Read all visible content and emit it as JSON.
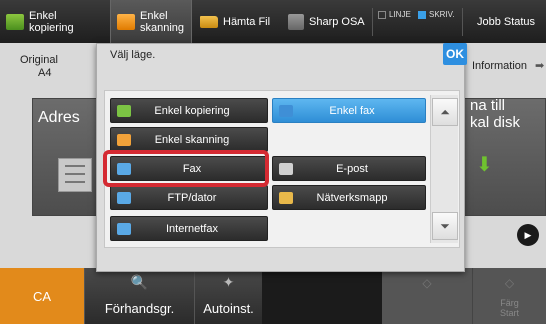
{
  "topbar": {
    "tabs": [
      {
        "label1": "Enkel",
        "label2": "kopiering",
        "icon": "copy-icon"
      },
      {
        "label1": "Enkel",
        "label2": "skanning",
        "icon": "scan-icon"
      },
      {
        "label": "Hämta Fil",
        "icon": "folder-icon"
      },
      {
        "label": "Sharp OSA",
        "icon": "osa-icon"
      }
    ],
    "indicators": {
      "line": "LINJE",
      "print": "SKRIV."
    },
    "job_status": "Jobb Status"
  },
  "background": {
    "original_label": "Original",
    "original_value": "A4",
    "info_label": "Information",
    "address_label": "Adres",
    "right_label_1": "na till",
    "right_label_2": "kal disk"
  },
  "modal": {
    "title": "Välj läge.",
    "ok_label": "OK",
    "options": [
      {
        "label": "Enkel kopiering",
        "icon": "copy-icon",
        "selected": false
      },
      {
        "label": "Enkel fax",
        "icon": "fax-icon",
        "selected": true
      },
      {
        "label": "Enkel skanning",
        "icon": "scan-icon",
        "selected": false
      },
      {
        "label": "Fax",
        "icon": "fax-icon",
        "selected": false,
        "highlighted": true
      },
      {
        "label": "E-post",
        "icon": "email-icon",
        "selected": false
      },
      {
        "label": "FTP/dator",
        "icon": "ftp-icon",
        "selected": false
      },
      {
        "label": "Nätverksmapp",
        "icon": "network-folder-icon",
        "selected": false
      },
      {
        "label": "Internetfax",
        "icon": "internet-fax-icon",
        "selected": false
      }
    ]
  },
  "bottombar": {
    "ca": "CA",
    "preview": "Förhandsgr.",
    "auto": "Autoinst.",
    "color_start_1": "Färg",
    "color_start_2": "Start"
  },
  "colors": {
    "accent_blue": "#2e8fe0",
    "highlight_red": "#d42a32",
    "ca_orange": "#e28a1b"
  }
}
